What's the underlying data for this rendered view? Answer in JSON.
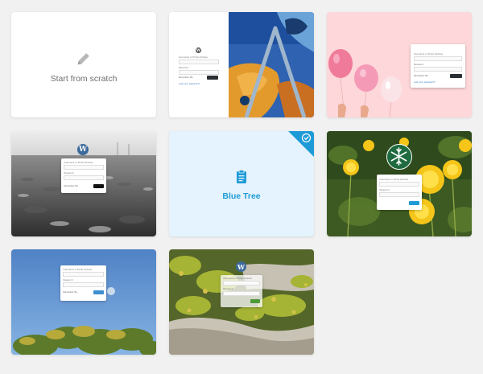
{
  "cards": [
    {
      "id": "scratch",
      "title": "Start from scratch"
    },
    {
      "id": "blue-tree",
      "title": "Blue Tree"
    }
  ],
  "login_form": {
    "username_label": "Username or Email Address",
    "password_label": "Password",
    "remember_label": "Remember Me",
    "lost_password": "Lost your password?"
  },
  "icons": {
    "pencil": "pencil-icon",
    "clipboard": "clipboard-icon",
    "check": "check-icon",
    "wordpress": "wordpress-logo",
    "snowflake": "snowflake-icon"
  },
  "colors": {
    "page_bg": "#f1f1f1",
    "blue_tree_bg": "#e4f3fd",
    "blue_accent": "#1e9bd7",
    "pink_bg": "#fdd7d9",
    "dark_button": "#2b2f33",
    "green_accent": "#1f6b3f"
  }
}
